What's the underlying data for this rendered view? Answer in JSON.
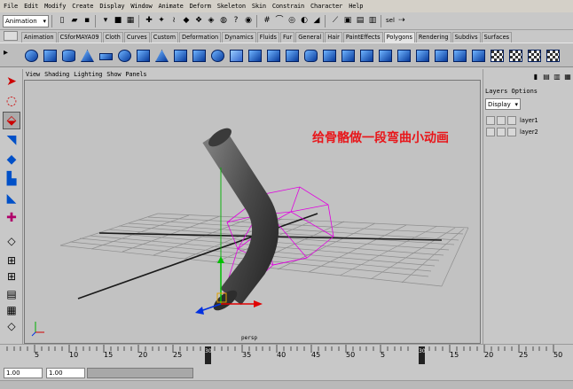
{
  "menubar": {
    "items": [
      "File",
      "Edit",
      "Modify",
      "Create",
      "Display",
      "Window",
      "Animate",
      "Deform",
      "Skeleton",
      "Skin",
      "Constrain",
      "Character",
      "Help"
    ]
  },
  "statusline": {
    "mode": "Animation",
    "select_label": "sel"
  },
  "shelf": {
    "tabs": [
      "Animation",
      "CSforMAYA09",
      "Cloth",
      "Curves",
      "Custom",
      "Deformation",
      "Dynamics",
      "Fluids",
      "Fur",
      "General",
      "Hair",
      "PaintEffects",
      "Polygons",
      "Rendering",
      "Subdivs",
      "Surfaces"
    ],
    "active_tab": "Polygons"
  },
  "panel": {
    "menu": [
      "View",
      "Shading",
      "Lighting",
      "Show",
      "Panels"
    ],
    "camera": "persp"
  },
  "viewport": {
    "annotation": "给骨骼做一段弯曲小动画",
    "annotation_color": "#e8161a"
  },
  "layers": {
    "menu": "Layers Options",
    "display": "Display",
    "items": [
      "layer1",
      "layer2"
    ]
  },
  "timeslider": {
    "tick_labels": [
      "5",
      "10",
      "15",
      "20",
      "25",
      "30",
      "35",
      "40",
      "45",
      "50"
    ],
    "current_frame": "30"
  },
  "range": {
    "start": "1.00",
    "inner_start": "1.00"
  }
}
